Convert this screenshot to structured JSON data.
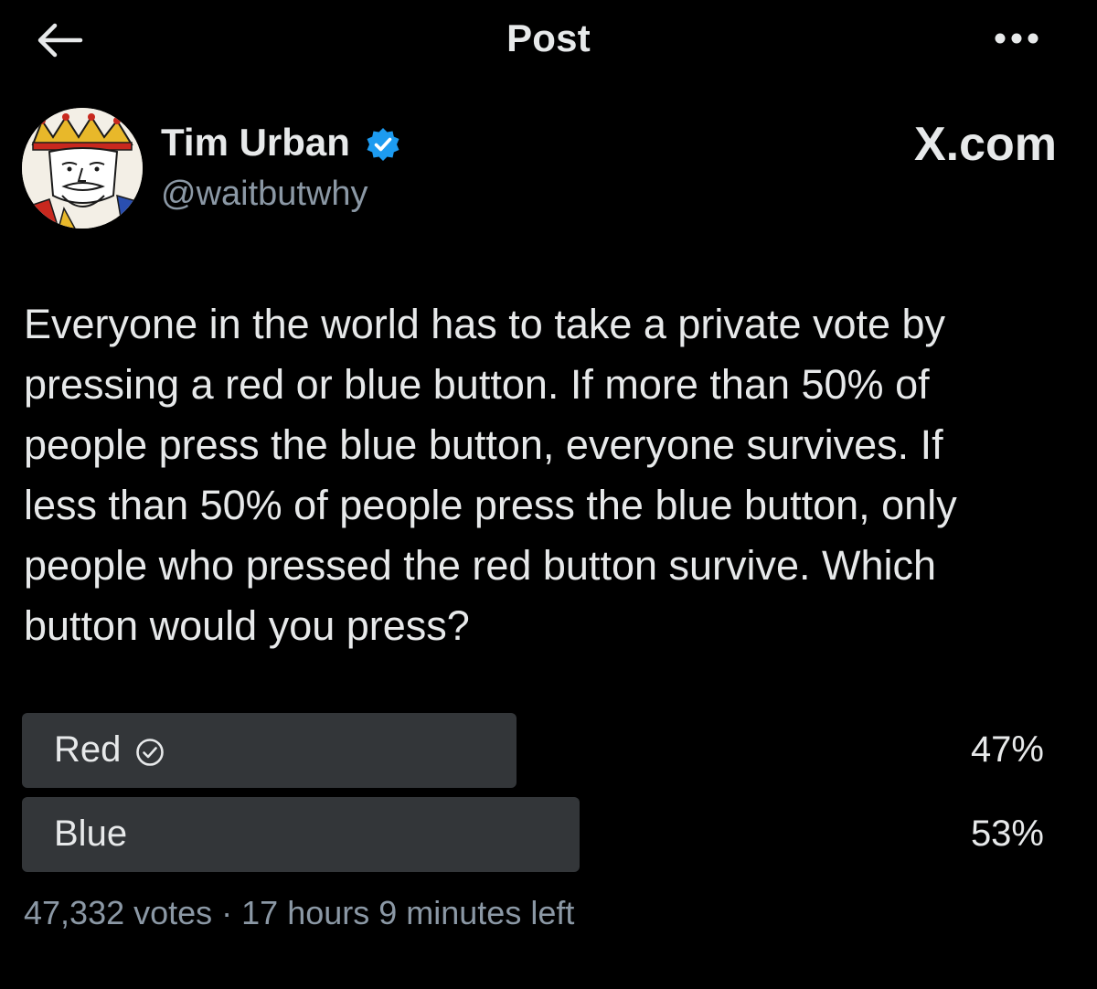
{
  "header": {
    "title": "Post",
    "back_icon": "arrow-left-icon",
    "more_icon": "ellipsis-icon"
  },
  "author": {
    "name": "Tim Urban",
    "handle": "@waitbutwhy",
    "verified": true,
    "avatar": "king-playing-card-avatar"
  },
  "watermark": "X.com",
  "post": {
    "text": "Everyone in the world has to take a private vote by\npressing a red or blue button. If more than 50% of\npeople press the blue button, everyone survives. If\nless than 50% of people press the blue button, only\npeople who pressed the red button survive. Which\nbutton would you press?"
  },
  "poll": {
    "options": [
      {
        "label": "Red",
        "percent_label": "47%",
        "percent": 47,
        "selected": true
      },
      {
        "label": "Blue",
        "percent_label": "53%",
        "percent": 53,
        "selected": false
      }
    ],
    "meta": "47,332 votes · 17 hours 9 minutes left"
  },
  "colors": {
    "background": "#000000",
    "text_primary": "#e7e9ea",
    "text_secondary": "#8b98a5",
    "poll_fill": "#333639",
    "verified_blue": "#1d9bf0"
  }
}
